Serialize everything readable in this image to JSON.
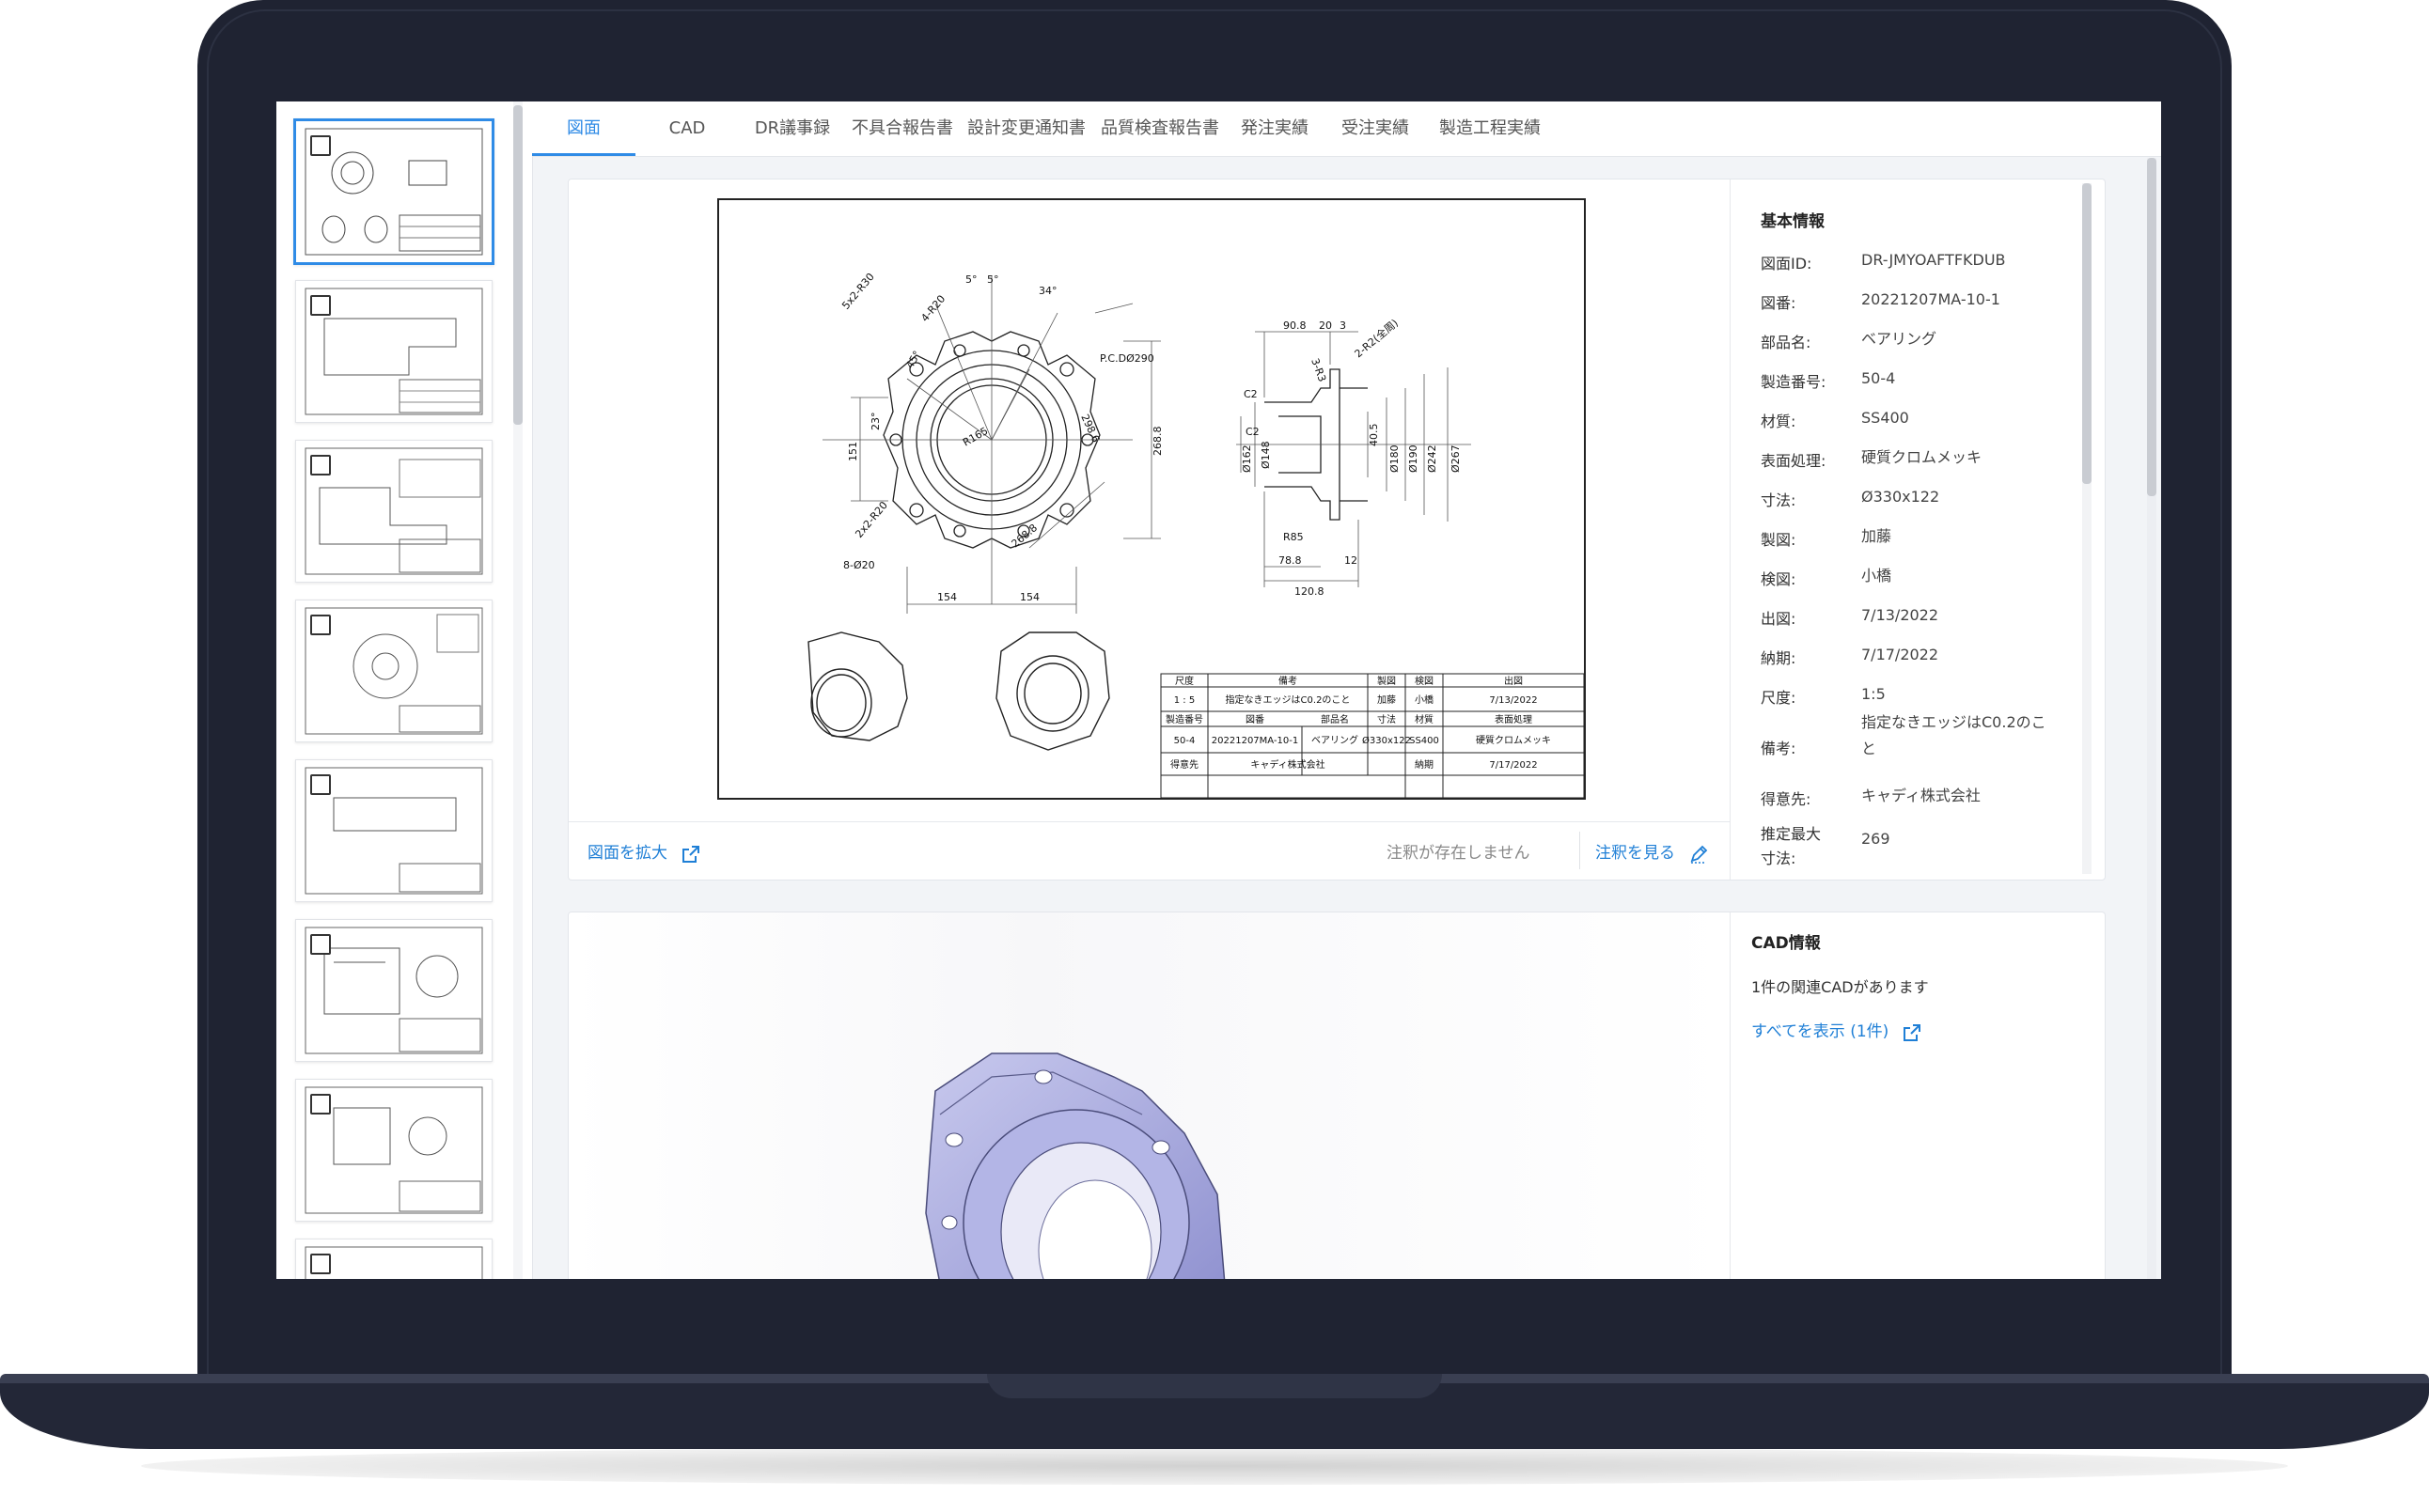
{
  "tabs": [
    {
      "label": "図面",
      "active": true
    },
    {
      "label": "CAD"
    },
    {
      "label": "DR議事録"
    },
    {
      "label": "不具合報告書"
    },
    {
      "label": "設計変更通知書"
    },
    {
      "label": "品質検査報告書"
    },
    {
      "label": "発注実績"
    },
    {
      "label": "受注実績"
    },
    {
      "label": "製造工程実績"
    }
  ],
  "drawing_card": {
    "expand_link": "図面を拡大",
    "no_annotation": "注釈が存在しません",
    "annotation_link": "注釈を見る"
  },
  "basic_info": {
    "title": "基本情報",
    "rows": [
      {
        "key": "図面ID:",
        "value": "DR-JMYOAFTFKDUB"
      },
      {
        "key": "図番:",
        "value": "20221207MA-10-1"
      },
      {
        "key": "部品名:",
        "value": "ベアリング"
      },
      {
        "key": "製造番号:",
        "value": "50-4"
      },
      {
        "key": "材質:",
        "value": "SS400"
      },
      {
        "key": "表面処理:",
        "value": "硬質クロムメッキ"
      },
      {
        "key": "寸法:",
        "value": "Ø330x122"
      },
      {
        "key": "製図:",
        "value": "加藤"
      },
      {
        "key": "検図:",
        "value": "小橋"
      },
      {
        "key": "出図:",
        "value": "7/13/2022"
      },
      {
        "key": "納期:",
        "value": "7/17/2022"
      },
      {
        "key": "尺度:",
        "value": "1:5"
      },
      {
        "key": "備考:",
        "value": "指定なきエッジはC0.2のこと"
      },
      {
        "key": "得意先:",
        "value": "キャディ株式会社"
      },
      {
        "key": "推定最大寸法:",
        "value": "269"
      }
    ]
  },
  "title_block": {
    "h_scale": "尺度",
    "h_note": "備考",
    "h_drafter": "製図",
    "h_checker": "検図",
    "h_issue": "出図",
    "scale": "1 : 5",
    "note": "指定なきエッジはC0.2のこと",
    "drafter": "加藤",
    "checker": "小橋",
    "issue": "7/13/2022",
    "h_serial": "製造番号",
    "h_drawno": "図番",
    "h_part": "部品名",
    "h_size": "寸法",
    "h_material": "材質",
    "h_surface": "表面処理",
    "serial": "50-4",
    "drawno": "20221207MA-10-1",
    "part": "ベアリング",
    "size": "Ø330x122",
    "material": "SS400",
    "surface": "硬質クロムメッキ",
    "h_customer": "得意先",
    "customer": "キャディ株式会社",
    "h_due": "納期",
    "due": "7/17/2022"
  },
  "dims": {
    "d1": "5x2-R30",
    "d2": "5°",
    "d3": "5°",
    "d4": "34°",
    "d5": "4-R20",
    "d6": "45°",
    "d7": "P.C.DØ290",
    "d8": "298.6",
    "d9": "268.8",
    "d10": "R165",
    "d11": "151",
    "d12": "23°",
    "d13": "2x2-R20",
    "d14": "8-Ø20",
    "d15": "268.8",
    "d16": "154",
    "d17": "154",
    "s1": "90.8",
    "s2": "20",
    "s3": "3",
    "s4": "3-R3",
    "s5": "2-R2(全周)",
    "s6": "C2",
    "s7": "C2",
    "s8": "Ø162",
    "s9": "Ø148",
    "s10": "40.5",
    "s11": "Ø180",
    "s12": "Ø190",
    "s13": "Ø242",
    "s14": "Ø267",
    "s15": "R85",
    "s16": "78.8",
    "s17": "12",
    "s18": "120.8"
  },
  "cad_info": {
    "title": "CAD情報",
    "count_text": "1件の関連CADがあります",
    "show_all": "すべてを表示 (1件)"
  },
  "colors": {
    "accent": "#2f8be6",
    "link": "#1f7fd6",
    "frame": "#1f2332",
    "cad_part": "#aeb0e0"
  }
}
